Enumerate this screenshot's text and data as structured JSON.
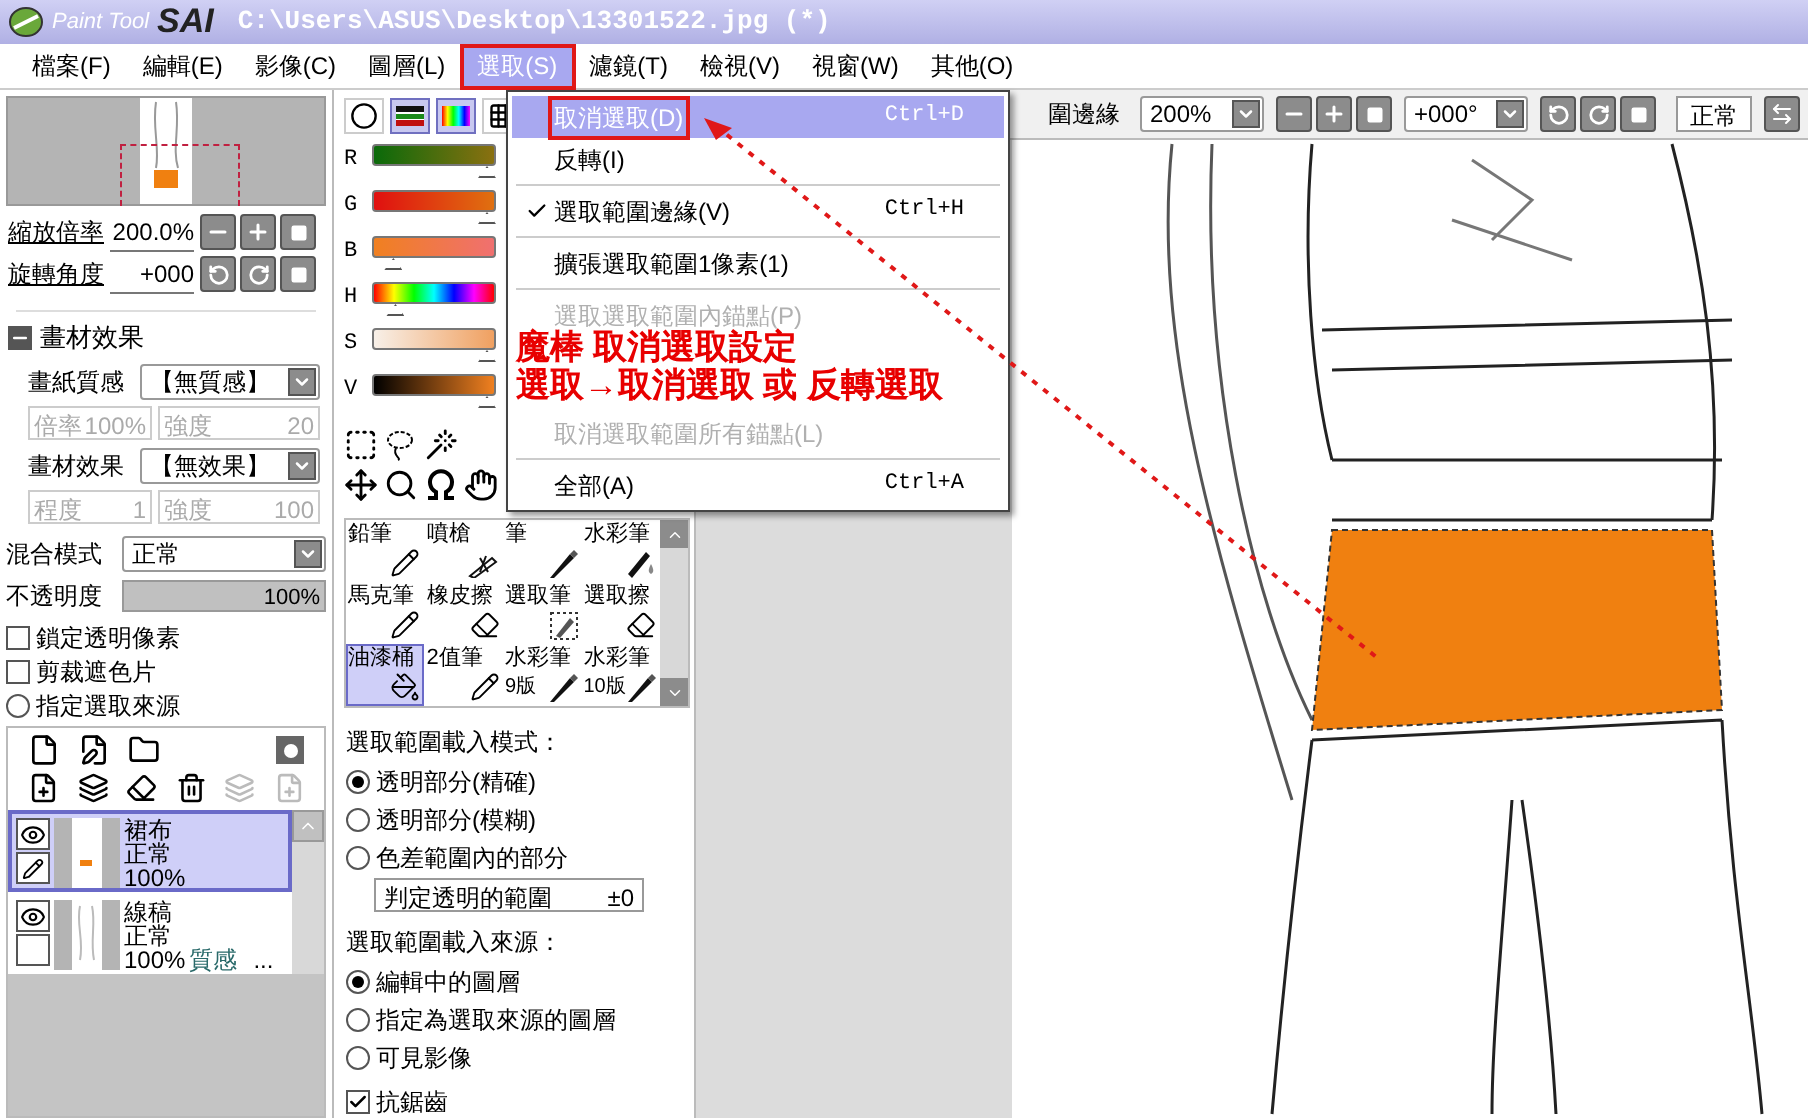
{
  "window": {
    "logo_small": "Paint Tool",
    "logo_large": "SAI",
    "title": "C:\\Users\\ASUS\\Desktop\\13301522.jpg (*)"
  },
  "menu_bar": [
    {
      "label": "檔案(F)",
      "selected": false
    },
    {
      "label": "編輯(E)",
      "selected": false
    },
    {
      "label": "影像(C)",
      "selected": false
    },
    {
      "label": "圖層(L)",
      "selected": false
    },
    {
      "label": "選取(S)",
      "selected": true
    },
    {
      "label": "濾鏡(T)",
      "selected": false
    },
    {
      "label": "檢視(V)",
      "selected": false
    },
    {
      "label": "視窗(W)",
      "selected": false
    },
    {
      "label": "其他(O)",
      "selected": false
    }
  ],
  "dropdown_menu": [
    {
      "kind": "item",
      "label": "取消選取(D)",
      "shortcut": "Ctrl+D",
      "selected": true,
      "checked": false,
      "disabled": false
    },
    {
      "kind": "item",
      "label": "反轉(I)",
      "selected": false,
      "checked": false,
      "disabled": false
    },
    {
      "kind": "separator"
    },
    {
      "kind": "item",
      "label": "選取範圍邊緣(V)",
      "shortcut": "Ctrl+H",
      "selected": false,
      "checked": true,
      "disabled": false
    },
    {
      "kind": "separator"
    },
    {
      "kind": "item",
      "label": "擴張選取範圍1像素(1)",
      "selected": false,
      "checked": false,
      "disabled": false
    },
    {
      "kind": "separator"
    },
    {
      "kind": "item",
      "label": "選取選取範圍內錨點(P)",
      "selected": false,
      "checked": false,
      "disabled": true
    },
    {
      "kind": "gap"
    },
    {
      "kind": "item",
      "label": "取消選取範圍所有錨點(L)",
      "selected": false,
      "checked": false,
      "disabled": true
    },
    {
      "kind": "separator"
    },
    {
      "kind": "item",
      "label": "全部(A)",
      "shortcut": "Ctrl+A",
      "selected": false,
      "checked": false,
      "disabled": false
    }
  ],
  "navigator": {
    "zoom_label": "縮放倍率",
    "zoom_value": "200.0%",
    "rotate_label": "旋轉角度",
    "rotate_value": "+000"
  },
  "texture_panel": {
    "title": "畫材效果",
    "expanded": true,
    "rows": [
      {
        "label": "畫紙質感",
        "value": "【無質感】",
        "sub_1_label": "倍率",
        "sub_1_value": "100%",
        "sub_2_label": "強度",
        "sub_2_value": "20"
      },
      {
        "label": "畫材效果",
        "value": "【無效果】",
        "sub_1_label": "程度",
        "sub_1_value": "1",
        "sub_2_label": "強度",
        "sub_2_value": "100"
      }
    ]
  },
  "blend": {
    "label": "混合模式",
    "value": "正常"
  },
  "opacity": {
    "label": "不透明度",
    "value": "100%",
    "level": 1
  },
  "layer_options": [
    {
      "kind": "checkbox",
      "label": "鎖定透明像素",
      "checked": false
    },
    {
      "kind": "checkbox",
      "label": "剪裁遮色片",
      "checked": false
    },
    {
      "kind": "radio",
      "label": "指定選取來源",
      "checked": false
    }
  ],
  "layers": [
    {
      "name": "裙布",
      "mode": "正常",
      "opacity": "100%",
      "selected": true,
      "visible": true,
      "kind": "fill"
    },
    {
      "name": "線稿",
      "mode": "正常",
      "opacity": "100%",
      "texture": "質感",
      "more": "...",
      "selected": false,
      "visible": true,
      "kind": "lineart"
    }
  ],
  "color_modes": [
    {
      "kind": "wheel",
      "selected": false
    },
    {
      "kind": "rgb",
      "selected": true
    },
    {
      "kind": "hsv",
      "selected": true
    },
    {
      "kind": "grid",
      "selected": false
    }
  ],
  "sliders": [
    {
      "label": "R",
      "level": 1
    },
    {
      "label": "G",
      "level": 1
    },
    {
      "label": "B",
      "level": 0.1
    },
    {
      "label": "H",
      "level": 0.12
    },
    {
      "label": "S",
      "level": 1
    },
    {
      "label": "V",
      "level": 1
    }
  ],
  "brushes": [
    {
      "name": "鉛筆",
      "kind": "pencil",
      "selected": false
    },
    {
      "name": "噴槍",
      "kind": "airbrush",
      "selected": false
    },
    {
      "name": "筆",
      "kind": "pen",
      "selected": false
    },
    {
      "name": "水彩筆",
      "kind": "watercolor",
      "selected": false
    },
    {
      "name": "馬克筆",
      "kind": "pencil",
      "selected": false
    },
    {
      "name": "橡皮擦",
      "kind": "eraser",
      "selected": false
    },
    {
      "name": "選取筆",
      "kind": "select-pen",
      "selected": false
    },
    {
      "name": "選取擦",
      "kind": "eraser",
      "selected": false
    },
    {
      "name": "油漆桶",
      "kind": "bucket",
      "selected": true
    },
    {
      "name": "2值筆",
      "kind": "pencil",
      "selected": false
    },
    {
      "name": "水彩筆",
      "sub": "9版",
      "kind": "pen",
      "selected": false
    },
    {
      "name": "水彩筆",
      "sub": "10版",
      "kind": "pen",
      "selected": false
    }
  ],
  "selection_settings": {
    "mode_title": "選取範圍載入模式：",
    "mode_options": [
      {
        "label": "透明部分(精確)",
        "selected": true
      },
      {
        "label": "透明部分(模糊)",
        "selected": false
      },
      {
        "label": "色差範圍內的部分",
        "selected": false
      }
    ],
    "range_label": "判定透明的範圍",
    "range_value": "±0",
    "source_title": "選取範圍載入來源：",
    "source_options": [
      {
        "label": "編輯中的圖層",
        "selected": true
      },
      {
        "label": "指定為選取來源的圖層",
        "selected": false
      },
      {
        "label": "可見影像",
        "selected": false
      }
    ],
    "antialias": {
      "label": "抗鋸齒",
      "checked": true
    }
  },
  "canvas_toolbar": {
    "label": "圍邊緣",
    "zoom": "200%",
    "rotation": "+000°",
    "blend": "正常"
  },
  "annotation": {
    "lines": [
      "魔棒 取消選取設定",
      "選取→取消選取 或 反轉選取"
    ]
  }
}
